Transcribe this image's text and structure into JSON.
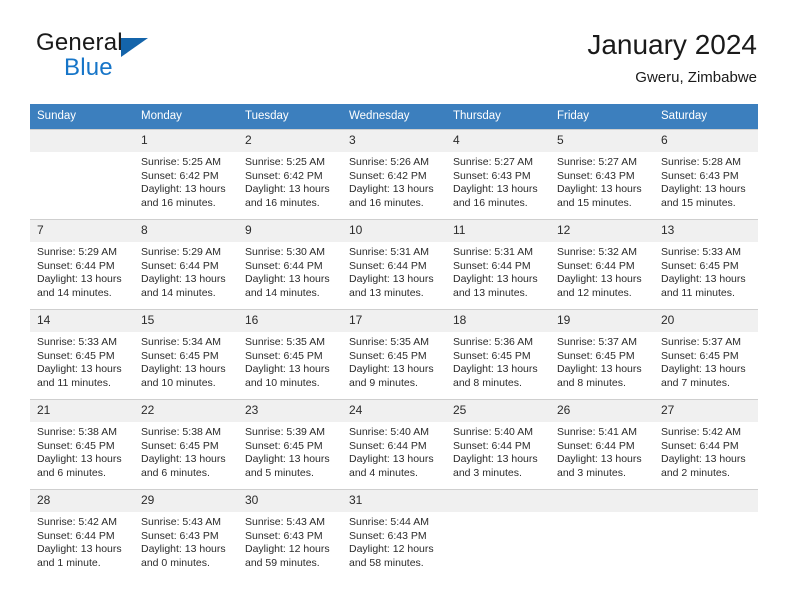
{
  "brand": {
    "name_top": "General",
    "name_bottom": "Blue",
    "triangle_color": "#1464aa",
    "blue_color": "#1675c8"
  },
  "header": {
    "title": "January 2024",
    "subtitle": "Gweru, Zimbabwe"
  },
  "theme": {
    "header_row_bg": "#3c7fbe",
    "header_row_text": "#ffffff",
    "daynum_bg": "#f0f0f0",
    "grid_line": "#cfcfcf"
  },
  "calendar": {
    "weekday_headers": [
      "Sunday",
      "Monday",
      "Tuesday",
      "Wednesday",
      "Thursday",
      "Friday",
      "Saturday"
    ],
    "weeks": [
      [
        {
          "day": "",
          "sunrise": "",
          "sunset": "",
          "daylight_line1": "",
          "daylight_line2": ""
        },
        {
          "day": "1",
          "sunrise": "Sunrise: 5:25 AM",
          "sunset": "Sunset: 6:42 PM",
          "daylight_line1": "Daylight: 13 hours",
          "daylight_line2": "and 16 minutes."
        },
        {
          "day": "2",
          "sunrise": "Sunrise: 5:25 AM",
          "sunset": "Sunset: 6:42 PM",
          "daylight_line1": "Daylight: 13 hours",
          "daylight_line2": "and 16 minutes."
        },
        {
          "day": "3",
          "sunrise": "Sunrise: 5:26 AM",
          "sunset": "Sunset: 6:42 PM",
          "daylight_line1": "Daylight: 13 hours",
          "daylight_line2": "and 16 minutes."
        },
        {
          "day": "4",
          "sunrise": "Sunrise: 5:27 AM",
          "sunset": "Sunset: 6:43 PM",
          "daylight_line1": "Daylight: 13 hours",
          "daylight_line2": "and 16 minutes."
        },
        {
          "day": "5",
          "sunrise": "Sunrise: 5:27 AM",
          "sunset": "Sunset: 6:43 PM",
          "daylight_line1": "Daylight: 13 hours",
          "daylight_line2": "and 15 minutes."
        },
        {
          "day": "6",
          "sunrise": "Sunrise: 5:28 AM",
          "sunset": "Sunset: 6:43 PM",
          "daylight_line1": "Daylight: 13 hours",
          "daylight_line2": "and 15 minutes."
        }
      ],
      [
        {
          "day": "7",
          "sunrise": "Sunrise: 5:29 AM",
          "sunset": "Sunset: 6:44 PM",
          "daylight_line1": "Daylight: 13 hours",
          "daylight_line2": "and 14 minutes."
        },
        {
          "day": "8",
          "sunrise": "Sunrise: 5:29 AM",
          "sunset": "Sunset: 6:44 PM",
          "daylight_line1": "Daylight: 13 hours",
          "daylight_line2": "and 14 minutes."
        },
        {
          "day": "9",
          "sunrise": "Sunrise: 5:30 AM",
          "sunset": "Sunset: 6:44 PM",
          "daylight_line1": "Daylight: 13 hours",
          "daylight_line2": "and 14 minutes."
        },
        {
          "day": "10",
          "sunrise": "Sunrise: 5:31 AM",
          "sunset": "Sunset: 6:44 PM",
          "daylight_line1": "Daylight: 13 hours",
          "daylight_line2": "and 13 minutes."
        },
        {
          "day": "11",
          "sunrise": "Sunrise: 5:31 AM",
          "sunset": "Sunset: 6:44 PM",
          "daylight_line1": "Daylight: 13 hours",
          "daylight_line2": "and 13 minutes."
        },
        {
          "day": "12",
          "sunrise": "Sunrise: 5:32 AM",
          "sunset": "Sunset: 6:44 PM",
          "daylight_line1": "Daylight: 13 hours",
          "daylight_line2": "and 12 minutes."
        },
        {
          "day": "13",
          "sunrise": "Sunrise: 5:33 AM",
          "sunset": "Sunset: 6:45 PM",
          "daylight_line1": "Daylight: 13 hours",
          "daylight_line2": "and 11 minutes."
        }
      ],
      [
        {
          "day": "14",
          "sunrise": "Sunrise: 5:33 AM",
          "sunset": "Sunset: 6:45 PM",
          "daylight_line1": "Daylight: 13 hours",
          "daylight_line2": "and 11 minutes."
        },
        {
          "day": "15",
          "sunrise": "Sunrise: 5:34 AM",
          "sunset": "Sunset: 6:45 PM",
          "daylight_line1": "Daylight: 13 hours",
          "daylight_line2": "and 10 minutes."
        },
        {
          "day": "16",
          "sunrise": "Sunrise: 5:35 AM",
          "sunset": "Sunset: 6:45 PM",
          "daylight_line1": "Daylight: 13 hours",
          "daylight_line2": "and 10 minutes."
        },
        {
          "day": "17",
          "sunrise": "Sunrise: 5:35 AM",
          "sunset": "Sunset: 6:45 PM",
          "daylight_line1": "Daylight: 13 hours",
          "daylight_line2": "and 9 minutes."
        },
        {
          "day": "18",
          "sunrise": "Sunrise: 5:36 AM",
          "sunset": "Sunset: 6:45 PM",
          "daylight_line1": "Daylight: 13 hours",
          "daylight_line2": "and 8 minutes."
        },
        {
          "day": "19",
          "sunrise": "Sunrise: 5:37 AM",
          "sunset": "Sunset: 6:45 PM",
          "daylight_line1": "Daylight: 13 hours",
          "daylight_line2": "and 8 minutes."
        },
        {
          "day": "20",
          "sunrise": "Sunrise: 5:37 AM",
          "sunset": "Sunset: 6:45 PM",
          "daylight_line1": "Daylight: 13 hours",
          "daylight_line2": "and 7 minutes."
        }
      ],
      [
        {
          "day": "21",
          "sunrise": "Sunrise: 5:38 AM",
          "sunset": "Sunset: 6:45 PM",
          "daylight_line1": "Daylight: 13 hours",
          "daylight_line2": "and 6 minutes."
        },
        {
          "day": "22",
          "sunrise": "Sunrise: 5:38 AM",
          "sunset": "Sunset: 6:45 PM",
          "daylight_line1": "Daylight: 13 hours",
          "daylight_line2": "and 6 minutes."
        },
        {
          "day": "23",
          "sunrise": "Sunrise: 5:39 AM",
          "sunset": "Sunset: 6:45 PM",
          "daylight_line1": "Daylight: 13 hours",
          "daylight_line2": "and 5 minutes."
        },
        {
          "day": "24",
          "sunrise": "Sunrise: 5:40 AM",
          "sunset": "Sunset: 6:44 PM",
          "daylight_line1": "Daylight: 13 hours",
          "daylight_line2": "and 4 minutes."
        },
        {
          "day": "25",
          "sunrise": "Sunrise: 5:40 AM",
          "sunset": "Sunset: 6:44 PM",
          "daylight_line1": "Daylight: 13 hours",
          "daylight_line2": "and 3 minutes."
        },
        {
          "day": "26",
          "sunrise": "Sunrise: 5:41 AM",
          "sunset": "Sunset: 6:44 PM",
          "daylight_line1": "Daylight: 13 hours",
          "daylight_line2": "and 3 minutes."
        },
        {
          "day": "27",
          "sunrise": "Sunrise: 5:42 AM",
          "sunset": "Sunset: 6:44 PM",
          "daylight_line1": "Daylight: 13 hours",
          "daylight_line2": "and 2 minutes."
        }
      ],
      [
        {
          "day": "28",
          "sunrise": "Sunrise: 5:42 AM",
          "sunset": "Sunset: 6:44 PM",
          "daylight_line1": "Daylight: 13 hours",
          "daylight_line2": "and 1 minute."
        },
        {
          "day": "29",
          "sunrise": "Sunrise: 5:43 AM",
          "sunset": "Sunset: 6:43 PM",
          "daylight_line1": "Daylight: 13 hours",
          "daylight_line2": "and 0 minutes."
        },
        {
          "day": "30",
          "sunrise": "Sunrise: 5:43 AM",
          "sunset": "Sunset: 6:43 PM",
          "daylight_line1": "Daylight: 12 hours",
          "daylight_line2": "and 59 minutes."
        },
        {
          "day": "31",
          "sunrise": "Sunrise: 5:44 AM",
          "sunset": "Sunset: 6:43 PM",
          "daylight_line1": "Daylight: 12 hours",
          "daylight_line2": "and 58 minutes."
        },
        {
          "day": "",
          "sunrise": "",
          "sunset": "",
          "daylight_line1": "",
          "daylight_line2": ""
        },
        {
          "day": "",
          "sunrise": "",
          "sunset": "",
          "daylight_line1": "",
          "daylight_line2": ""
        },
        {
          "day": "",
          "sunrise": "",
          "sunset": "",
          "daylight_line1": "",
          "daylight_line2": ""
        }
      ]
    ]
  }
}
